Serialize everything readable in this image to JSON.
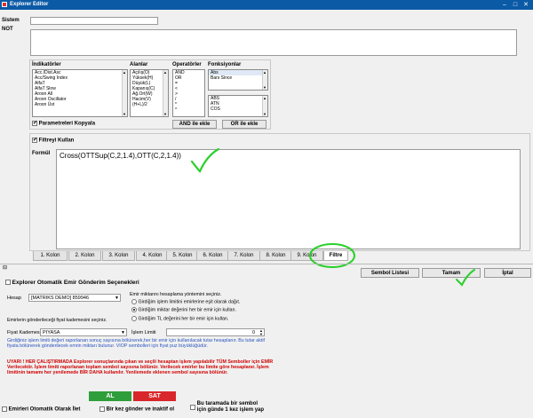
{
  "window": {
    "title": "Explorer Editor"
  },
  "header": {
    "sistem_label": "Sistem",
    "sistem_value": "",
    "not_label": "NOT",
    "not_value": ""
  },
  "panels": {
    "indicators": {
      "title": "İndikatörler",
      "items": [
        "Acc./Dist.Asc",
        "Acc/Swing Index",
        "AlfaT",
        "AlfaT Slow",
        "Aroon All",
        "Aroon Oscillator",
        "Aroon Üst"
      ]
    },
    "bars": {
      "title": "Alanlar",
      "items": [
        "Açılış(O)",
        "Yüksek(H)",
        "Düşük(L)",
        "Kapanış(C)",
        "Ağ.Ort(W)",
        "Hacim(V)",
        "(H+L)/2"
      ]
    },
    "operators": {
      "title": "Operatörler",
      "items": [
        "AND",
        "OR",
        "=",
        "<",
        ">",
        "/",
        "*",
        "^"
      ]
    },
    "functions": {
      "title": "Fonksiyonlar",
      "top_items": [
        "Abs",
        "Bars Since",
        ""
      ],
      "bottom_items": [
        "ABS",
        "ATN",
        "COS"
      ]
    },
    "param_copy": {
      "label": "Parametreleri Kopyala",
      "checked": true
    },
    "and_button": "AND ile ekle",
    "or_button": "OR ile ekle"
  },
  "filter": {
    "checkbox_label": "Filtreyi Kullan",
    "checked": true,
    "formula_label": "Formül",
    "formula": "Cross(OTTSup(C,2,1.4),OTT(C,2,1.4))"
  },
  "tabs": [
    "1. Kolon",
    "2. Kolon",
    "3. Kolon",
    "4. Kolon",
    "5. Kolon",
    "6. Kolon",
    "7. Kolon",
    "8. Kolon",
    "9. Kolon",
    "Filtre"
  ],
  "actions": {
    "symbol_list": "Sembol Listesi",
    "ok": "Tamam",
    "cancel": "İptal"
  },
  "order": {
    "section_title": "Explorer Otomatik Emir Gönderim Seçenekleri",
    "account_label": "Hesap",
    "account_value": "[MATRIKS DEMO] 859946",
    "mode_hint": "Emir miktarını hesaplama yöntemini seçiniz.",
    "radio_options": [
      "Girdiğim işlem limitini emirlerine eşit olarak dağıt.",
      "Girdiğim miktar değerini her bir emir için kullan.",
      "Girdiğim TL değerini her bir emir için kullan."
    ],
    "price_hint": "Emirlerin gönderileceği fiyat kademesini seçiniz.",
    "price_label": "Fiyat Kademesi",
    "price_value": "PIYASA",
    "limit_label": "İşlem Limiti",
    "limit_value": "0",
    "info_text": "Girdiğiniz işlem limiti değeri raporlanan sonuç sayısına bölünerek,her bir emir için kullanılacak tutar hesaplanır. Bu tutar aktif fiyata bölünerek gönderilecek emrin miktarı bulunur. VIOP sembolleri için fiyat puz büyüklüğüdür.",
    "warning_text": "UYARI ! HER ÇALIŞTIRMADA Explorer sonuçlarında çıkan ve seçili hesaptan işlem yapılabilir TÜM Semboller için EMİR Verilecektir. İşlem limiti raporlanan toplam sembol sayısına bölünür. Verilecek emirler bu limite göre hesaplanır. İşlem limitinin tamamı her yenilemede BİR DAHA kullanılır. Yenilemede eklenen sembol sayısına bölünür.",
    "buy": "AL",
    "sell": "SAT",
    "buy_color": "#2e9e3a",
    "sell_color": "#d8262b"
  },
  "footer": {
    "auto_label": "Emirleri Otomatik Olarak İlet",
    "once_label": "Bir kez gönder ve inaktif ol",
    "daily_label_1": "Bu taramada bir sembol",
    "daily_label_2": "için günde 1 kez işlem yap"
  },
  "colors": {
    "titlebar": "#0b5aa6"
  }
}
